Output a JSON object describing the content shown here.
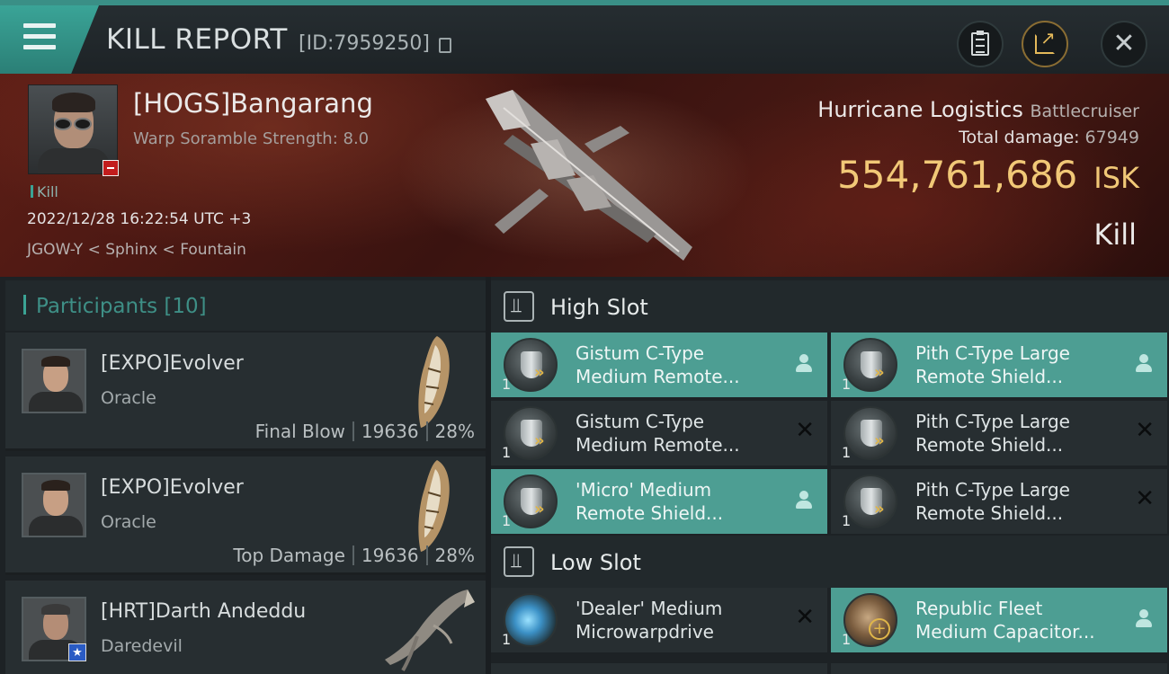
{
  "window": {
    "title": "KILL REPORT",
    "id_label": "[ID:7959250]",
    "icons": [
      "menu-icon",
      "copy-icon",
      "clipboard-icon",
      "share-icon",
      "close-icon"
    ]
  },
  "victim": {
    "name": "[HOGS]Bangarang",
    "scramble": "Warp Soramble Strength: 8.0",
    "tag": "Kill",
    "datetime": "2022/12/28 16:22:54 UTC +3",
    "location": "JGOW-Y < Sphinx < Fountain"
  },
  "ship": {
    "name": "Hurricane Logistics",
    "class": "Battlecruiser",
    "damage_label": "Total damage:",
    "damage_value": "67949",
    "isk_value": "554,761,686",
    "isk_unit": "ISK",
    "result": "Kill"
  },
  "participants": {
    "header": "Participants [10]",
    "rows": [
      {
        "name": "[EXPO]Evolver",
        "ship": "Oracle",
        "role": "Final Blow",
        "damage": "19636",
        "percent": "28%"
      },
      {
        "name": "[EXPO]Evolver",
        "ship": "Oracle",
        "role": "Top Damage",
        "damage": "19636",
        "percent": "28%"
      },
      {
        "name": "[HRT]Darth Andeddu",
        "ship": "Daredevil"
      }
    ]
  },
  "fitting": {
    "high_slot": {
      "title": "High Slot",
      "items": [
        {
          "line1": "Gistum C-Type",
          "line2": "Medium Remote...",
          "qty": "1",
          "active": true
        },
        {
          "line1": "Pith C-Type Large",
          "line2": "Remote Shield...",
          "qty": "1",
          "active": true
        },
        {
          "line1": "Gistum C-Type",
          "line2": "Medium Remote...",
          "qty": "1",
          "active": false
        },
        {
          "line1": "Pith C-Type Large",
          "line2": "Remote Shield...",
          "qty": "1",
          "active": false
        },
        {
          "line1": "'Micro' Medium",
          "line2": "Remote Shield...",
          "qty": "1",
          "active": true
        },
        {
          "line1": "Pith C-Type Large",
          "line2": "Remote Shield...",
          "qty": "1",
          "active": false
        }
      ]
    },
    "low_slot": {
      "title": "Low Slot",
      "items": [
        {
          "line1": "'Dealer' Medium",
          "line2": "Microwarpdrive",
          "qty": "1",
          "active": false
        },
        {
          "line1": "Republic Fleet",
          "line2": "Medium Capacitor...",
          "qty": "1",
          "active": true
        }
      ]
    }
  },
  "colors": {
    "accent": "#3ba394",
    "isk_gold": "#f1c877",
    "active_item": "#4d9e93",
    "banner_red": "#5e1e16"
  }
}
